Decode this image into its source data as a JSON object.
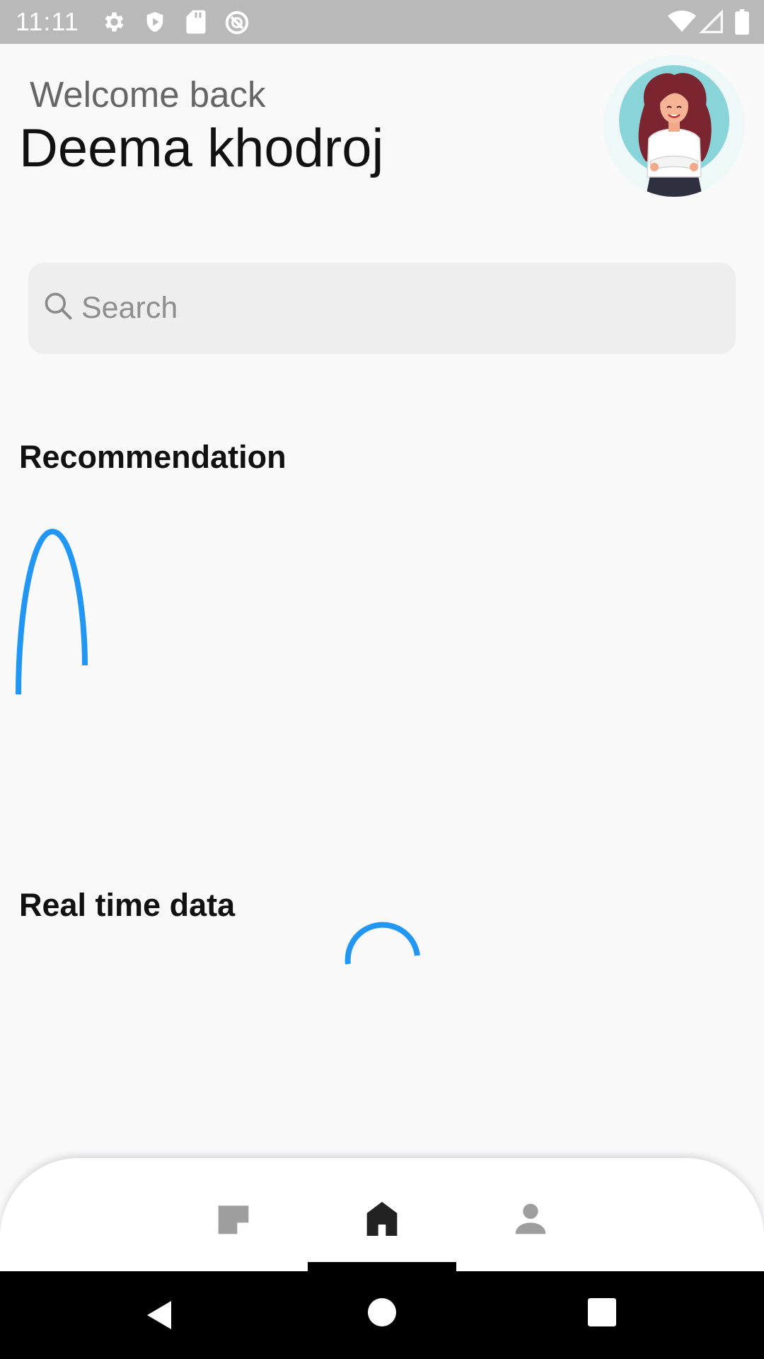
{
  "status_bar": {
    "time": "11:11",
    "left_icons": [
      "gear-icon",
      "shield-play-icon",
      "sd-card-icon",
      "do-not-disturb-icon"
    ],
    "right_icons": [
      "wifi-icon",
      "signal-icon",
      "battery-icon"
    ]
  },
  "header": {
    "greeting": "Welcome back",
    "user_name": "Deema khodroj",
    "avatar_icon": "woman-avatar-illustration"
  },
  "search": {
    "placeholder": "Search",
    "value": ""
  },
  "sections": {
    "recommendation": "Recommendation",
    "real_time": "Real time data"
  },
  "bottom_nav": {
    "items": [
      {
        "icon": "note-icon",
        "active": false
      },
      {
        "icon": "home-icon",
        "active": true
      },
      {
        "icon": "person-icon",
        "active": false
      }
    ]
  },
  "colors": {
    "accent": "#2196f3",
    "status_bar": "#b9b9b9",
    "background": "#f9f9fa",
    "inactive_icon": "#9e9e9e",
    "active_icon": "#222222"
  }
}
